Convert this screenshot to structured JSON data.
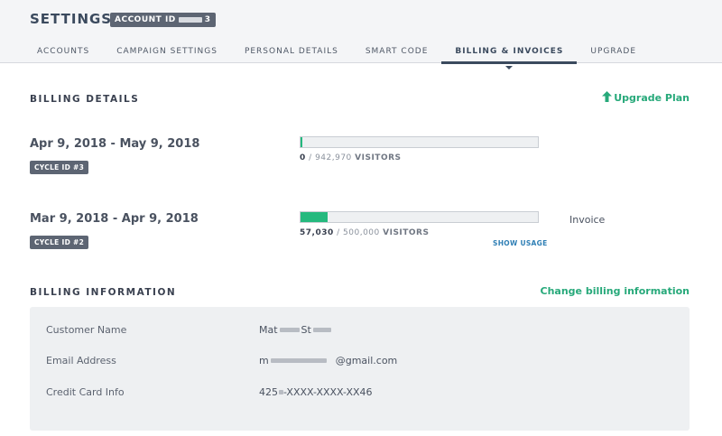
{
  "header": {
    "title": "SETTINGS",
    "account_label": "ACCOUNT ID",
    "account_suffix": "3"
  },
  "tabs": [
    {
      "label": "ACCOUNTS",
      "active": false
    },
    {
      "label": "CAMPAIGN SETTINGS",
      "active": false
    },
    {
      "label": "PERSONAL DETAILS",
      "active": false
    },
    {
      "label": "SMART CODE",
      "active": false
    },
    {
      "label": "BILLING & INVOICES",
      "active": true
    },
    {
      "label": "UPGRADE",
      "active": false
    }
  ],
  "billing_details": {
    "title": "BILLING DETAILS",
    "upgrade_label": "Upgrade Plan",
    "upgrade_icon": "arrow-up-icon",
    "cycles": [
      {
        "dates": "Apr 9, 2018 - May 9, 2018",
        "badge": "CYCLE ID #3",
        "used": "0",
        "separator": "/",
        "limit": "942,970",
        "unit": "VISITORS",
        "progress_percent": 0
      },
      {
        "dates": "Mar 9, 2018 - Apr 9, 2018",
        "badge": "CYCLE ID #2",
        "used": "57,030",
        "separator": "/",
        "limit": "500,000",
        "unit": "VISITORS",
        "progress_percent": 11.4,
        "show_usage": "SHOW USAGE",
        "invoice": "Invoice"
      }
    ]
  },
  "billing_information": {
    "title": "BILLING INFORMATION",
    "change_label": "Change billing information",
    "fields": {
      "customer_name_label": "Customer Name",
      "customer_name_first": "Mat",
      "customer_name_last": "St",
      "email_label": "Email Address",
      "email_first": "m",
      "email_domain": "@gmail.com",
      "card_label": "Credit Card Info",
      "card_prefix": "425",
      "card_rest": "-XXXX-XXXX-XX46"
    }
  },
  "colors": {
    "accent_green": "#25b97e",
    "link_green": "#27a97a",
    "dark_navy": "#3b4a5e",
    "badge_gray": "#5d6573",
    "panel_bg": "#eef0f2"
  }
}
